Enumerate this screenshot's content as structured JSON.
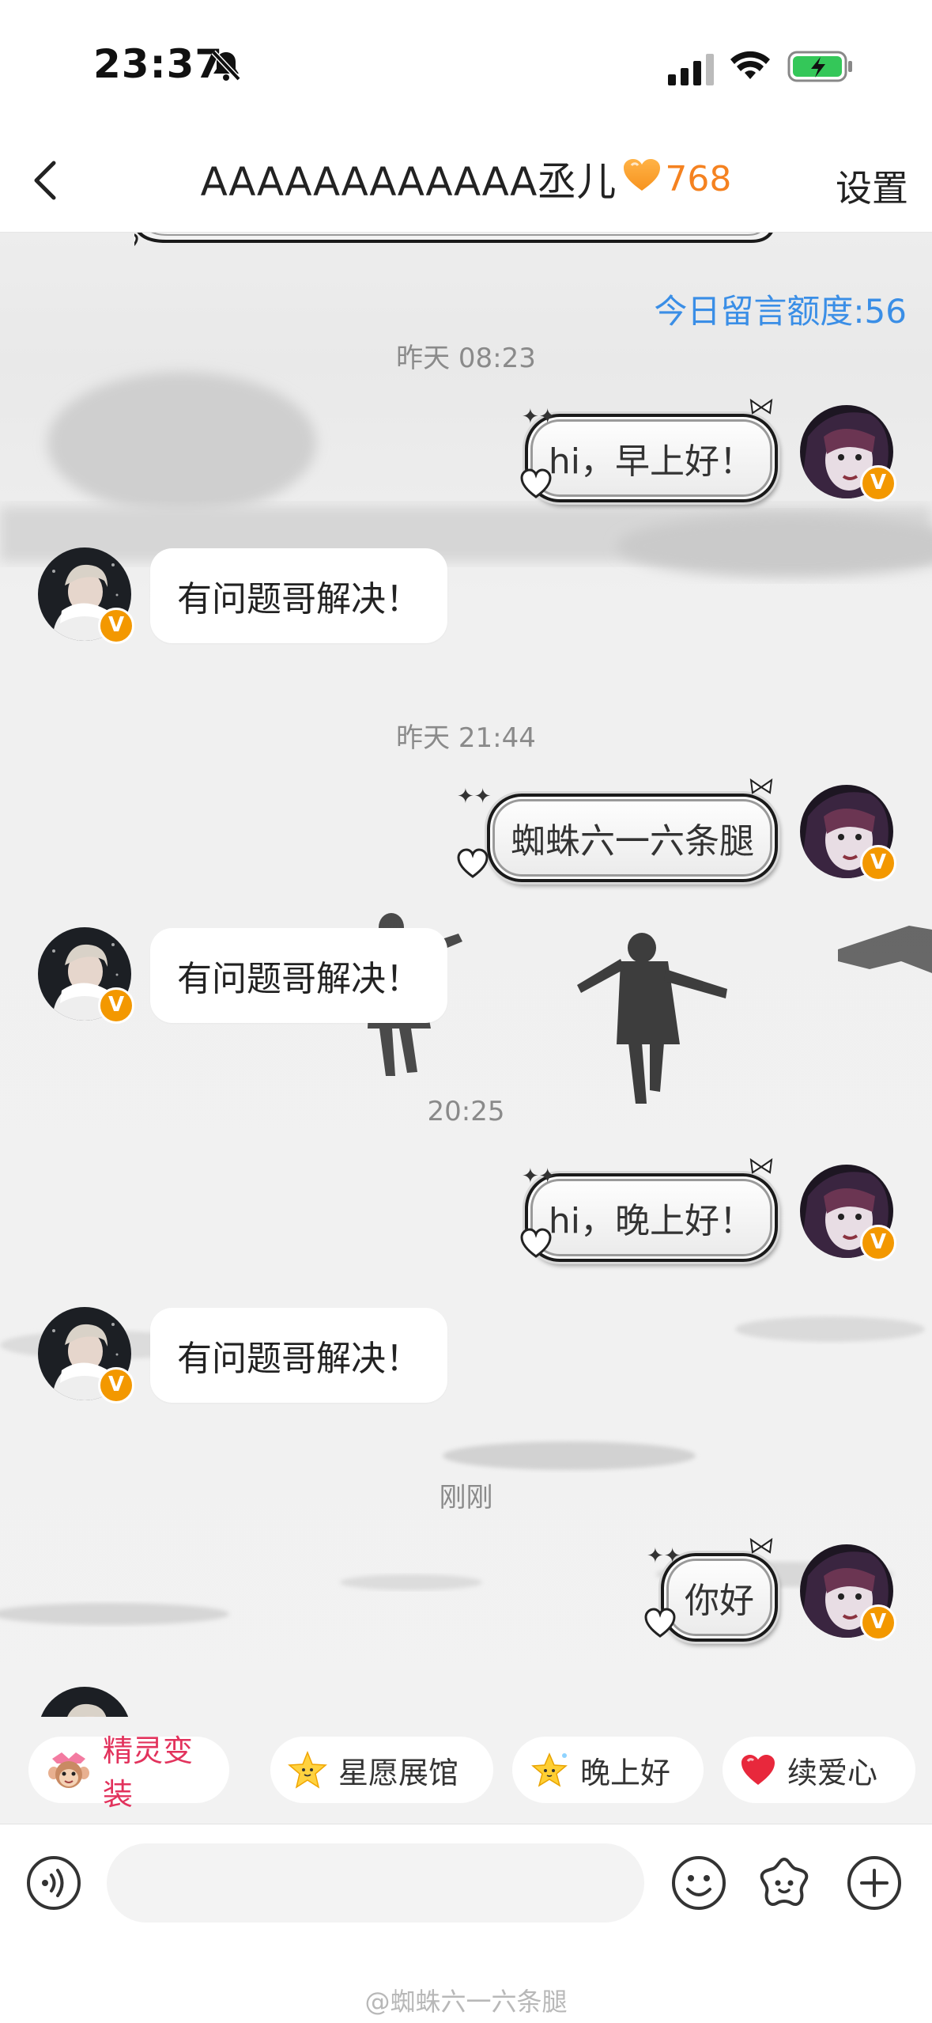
{
  "status_bar": {
    "time": "23:37",
    "battery_state": "charging"
  },
  "header": {
    "title": "AAAAAAAAAAAA丞儿",
    "intimacy_count": "768",
    "settings_label": "设置"
  },
  "quota_text": "今日留言额度:56",
  "timestamps": [
    "昨天 08:23",
    "昨天 21:44",
    "20:25",
    "刚刚"
  ],
  "messages": {
    "m1": "hi，早上好！",
    "m2": "有问题哥解决！",
    "m3": "蜘蛛六一六条腿",
    "m4": "有问题哥解决！",
    "m5": "hi，晚上好！",
    "m6": "有问题哥解决！",
    "m7": "你好"
  },
  "quick_chips": [
    "精灵变装",
    "星愿展馆",
    "晚上好",
    "续爱心"
  ],
  "input": {
    "placeholder": ""
  },
  "badge_letter": "V",
  "watermark": "@蜘蛛六一六条腿",
  "colors": {
    "accent_orange": "#f58220",
    "link_blue": "#3a8ee6",
    "verify_badge": "#f39800",
    "chip_hot": "#e2325c"
  },
  "icons": [
    "bell-slash-icon",
    "signal-icon",
    "wifi-icon",
    "battery-charging-icon",
    "back-chevron-icon",
    "heart-icon",
    "voice-icon",
    "emoji-icon",
    "sticker-icon",
    "plus-icon"
  ]
}
